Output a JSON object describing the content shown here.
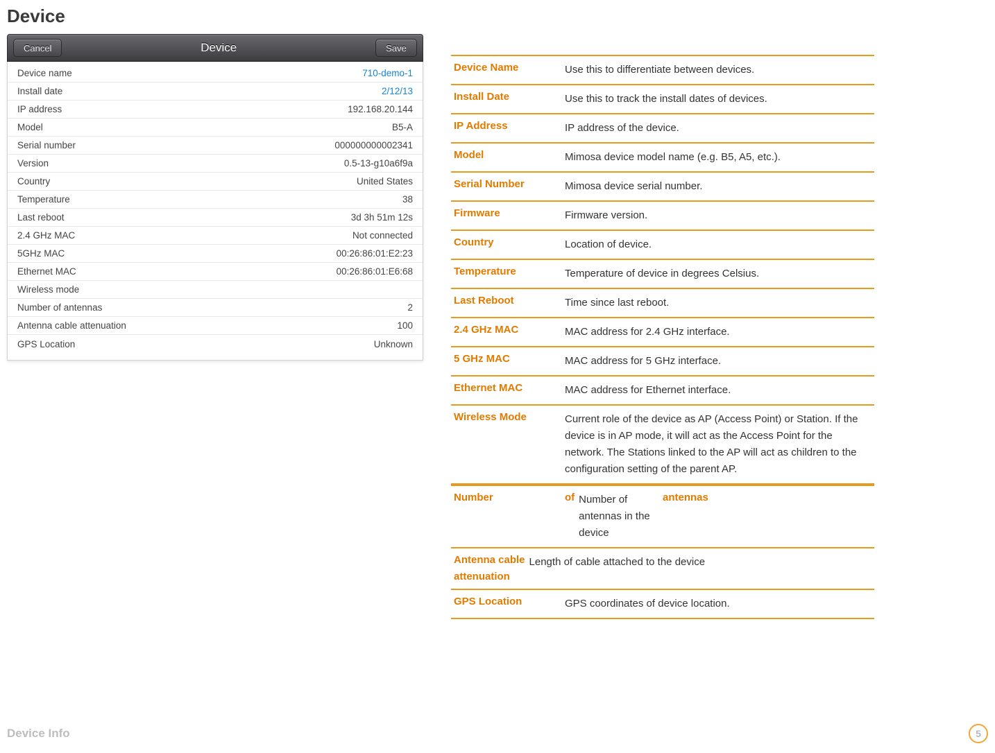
{
  "page": {
    "title": "Device",
    "footer_label": "Device Info",
    "page_number": "5"
  },
  "panel": {
    "cancel": "Cancel",
    "save": "Save",
    "title": "Device",
    "rows": [
      {
        "label": "Device name",
        "value": "710-demo-1",
        "link": true
      },
      {
        "label": "Install date",
        "value": "2/12/13",
        "link": true
      },
      {
        "label": "IP address",
        "value": "192.168.20.144"
      },
      {
        "label": "Model",
        "value": "B5-A"
      },
      {
        "label": "Serial number",
        "value": "000000000002341"
      },
      {
        "label": "Version",
        "value": "0.5-13-g10a6f9a"
      },
      {
        "label": "Country",
        "value": "United States"
      },
      {
        "label": "Temperature",
        "value": "38"
      },
      {
        "label": "Last reboot",
        "value": "3d 3h 51m 12s"
      },
      {
        "label": "2.4 GHz MAC",
        "value": "Not connected"
      },
      {
        "label": "5GHz MAC",
        "value": "00:26:86:01:E2:23"
      },
      {
        "label": "Ethernet MAC",
        "value": "00:26:86:01:E6:68"
      },
      {
        "label": "Wireless mode",
        "value": ""
      },
      {
        "label": "Number of antennas",
        "value": "2"
      },
      {
        "label": "Antenna cable attenuation",
        "value": "100"
      },
      {
        "label": "GPS Location",
        "value": "Unknown"
      }
    ]
  },
  "defs": [
    {
      "label": "Device Name",
      "desc": "Use this to differentiate between devices."
    },
    {
      "label": "Install Date",
      "desc": "Use this to track the install dates of devices."
    },
    {
      "label": "IP Address",
      "desc": "IP address of the device."
    },
    {
      "label": "Model",
      "desc": "Mimosa device model name (e.g. B5, A5, etc.)."
    },
    {
      "label": "Serial Number",
      "desc": "Mimosa device serial number."
    },
    {
      "label": "Firmware",
      "desc": "Firmware version."
    },
    {
      "label": "Country",
      "desc": "Location of device."
    },
    {
      "label": "Temperature",
      "desc": "Temperature of device in degrees Celsius."
    },
    {
      "label": "Last Reboot",
      "desc": "Time since last reboot."
    },
    {
      "label": "2.4 GHz MAC",
      "desc": "MAC address for 2.4 GHz interface."
    },
    {
      "label": "5 GHz MAC",
      "desc": "MAC address for 5 GHz interface."
    },
    {
      "label": "Ethernet MAC",
      "desc": "MAC address for Ethernet interface."
    },
    {
      "label": "Wireless Mode",
      "desc": "Current role of the device as AP (Access Point) or Station. If the device is in AP mode, it will act as the Access Point for the network. The Stations linked to the AP will act as children to the configuration setting of the parent AP."
    }
  ],
  "num_antennas": {
    "label1": "Number",
    "of": "of",
    "label2": "antennas",
    "desc": "Number of antennas in the device"
  },
  "ant_cable": {
    "label1": "Antenna cable",
    "label2": "attenuation",
    "desc": "Length of cable attached to the device"
  },
  "gps": {
    "label": "GPS Location",
    "desc": "GPS coordinates of device location."
  }
}
